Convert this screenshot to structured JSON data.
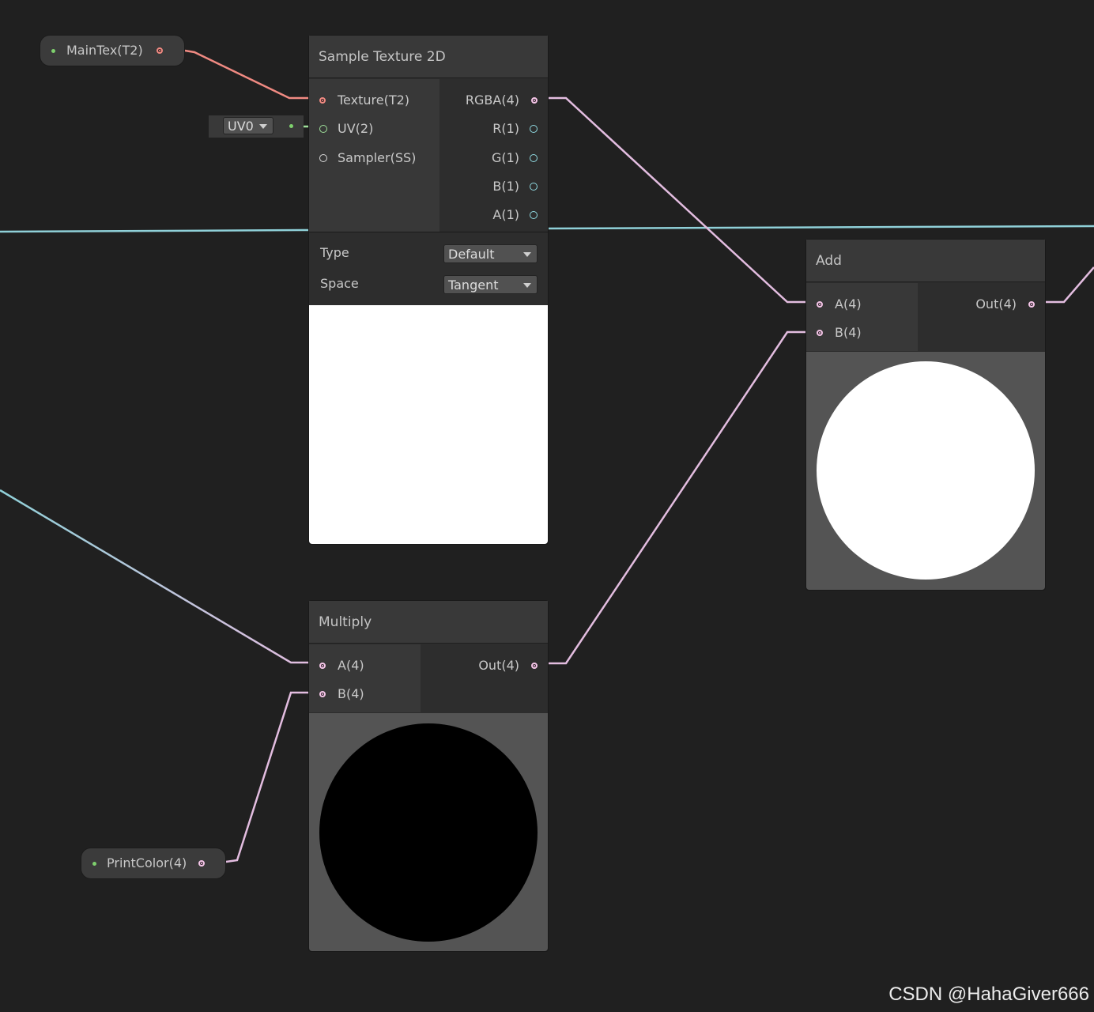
{
  "properties": {
    "maintex": {
      "label": "MainTex(T2)"
    },
    "printcolor": {
      "label": "PrintColor(4)"
    }
  },
  "uv_field": {
    "value": "UV0"
  },
  "sample_texture": {
    "title": "Sample Texture 2D",
    "inputs": [
      "Texture(T2)",
      "UV(2)",
      "Sampler(SS)"
    ],
    "outputs": [
      "RGBA(4)",
      "R(1)",
      "G(1)",
      "B(1)",
      "A(1)"
    ],
    "type_label": "Type",
    "type_value": "Default",
    "space_label": "Space",
    "space_value": "Tangent"
  },
  "multiply": {
    "title": "Multiply",
    "inputs": [
      "A(4)",
      "B(4)"
    ],
    "output": "Out(4)"
  },
  "add": {
    "title": "Add",
    "inputs": [
      "A(4)",
      "B(4)"
    ],
    "output": "Out(4)"
  },
  "watermark": "CSDN @HahaGiver666",
  "colors": {
    "background": "#202020",
    "wire_vector4": "#e3bde0",
    "wire_texture": "#f08a82",
    "wire_float": "#8fd0d8",
    "wire_uv": "#9fe09a"
  }
}
